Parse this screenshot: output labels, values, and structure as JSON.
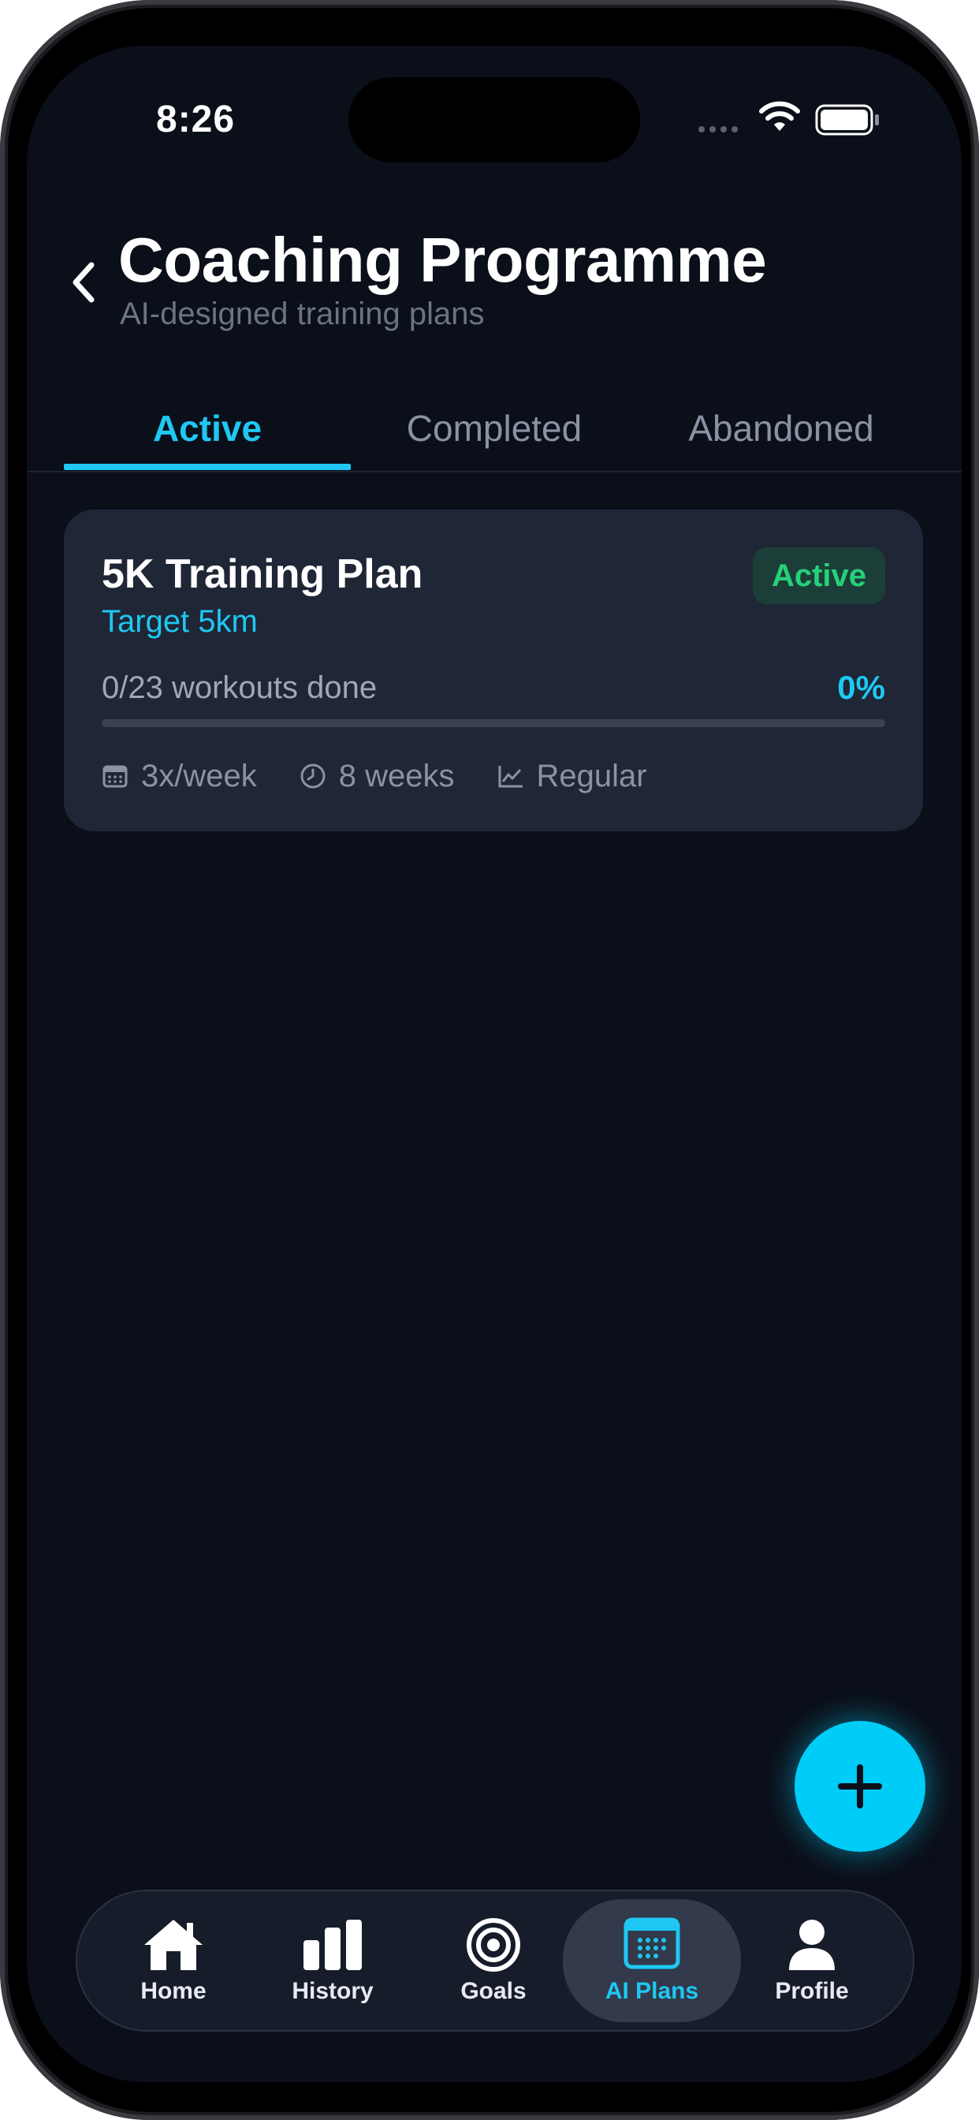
{
  "status_bar": {
    "time": "8:26"
  },
  "header": {
    "title": "Coaching Programme",
    "subtitle": "AI-designed training plans"
  },
  "tabs": [
    {
      "label": "Active",
      "selected": true
    },
    {
      "label": "Completed",
      "selected": false
    },
    {
      "label": "Abandoned",
      "selected": false
    }
  ],
  "plan_card": {
    "name": "5K Training Plan",
    "target": "Target 5km",
    "status": "Active",
    "progress_label": "0/23 workouts done",
    "progress_percent": "0%",
    "progress_fraction": 0,
    "meta": {
      "frequency": "3x/week",
      "duration": "8 weeks",
      "level": "Regular"
    }
  },
  "nav": [
    {
      "label": "Home",
      "icon": "home-icon",
      "active": false
    },
    {
      "label": "History",
      "icon": "bar-chart-icon",
      "active": false
    },
    {
      "label": "Goals",
      "icon": "target-icon",
      "active": false
    },
    {
      "label": "AI Plans",
      "icon": "calendar-icon",
      "active": true
    },
    {
      "label": "Profile",
      "icon": "person-icon",
      "active": false
    }
  ],
  "colors": {
    "background": "#0b0f19",
    "card": "#1f2636",
    "accent": "#1ec8f3",
    "success": "#27d07a",
    "fab": "#00cdf7"
  },
  "fab": {
    "icon": "plus-icon"
  }
}
